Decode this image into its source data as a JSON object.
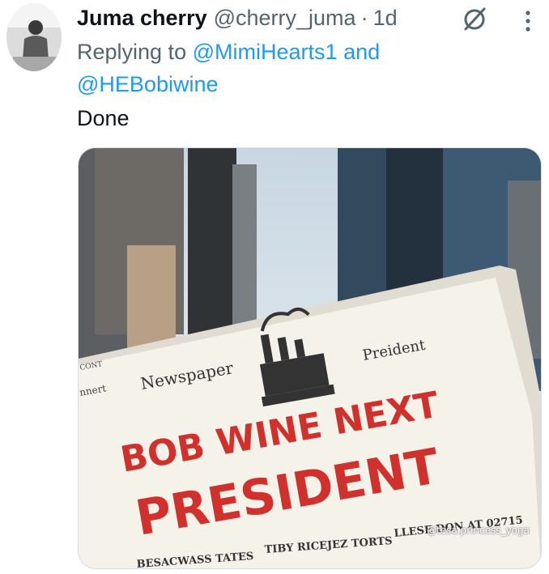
{
  "tweet": {
    "display_name": "Juma cherry",
    "handle": "@cherry_juma",
    "separator": "·",
    "time": "1d",
    "replying_prefix": "Replying to",
    "mention_1": "@MimiHearts1",
    "and_word": "and",
    "mention_2": "@HEBobiwine",
    "text": "Done"
  },
  "media": {
    "newspaper_masthead": "Newspaper",
    "newspaper_label": "Preident",
    "headline_line1": "BOB WINE NEXT",
    "headline_line2": "PRESIDENT",
    "sub_headline_left": "BESACWASS TATES",
    "sub_headline_mid": "TIBY RICEJEZ TORTS",
    "sub_headline_right": "LLESE DON AT 02715",
    "side_tab_1": "CONT",
    "side_tab_2": "nnert",
    "watermark": "@tesa.princess_yoga"
  },
  "icons": {
    "grok": "grok-icon",
    "more": "more-icon",
    "avatar": "avatar"
  },
  "colors": {
    "link": "#1d9bf0",
    "secondary_text": "#536471",
    "primary_text": "#0f1419",
    "headline_red": "#d0312d"
  }
}
